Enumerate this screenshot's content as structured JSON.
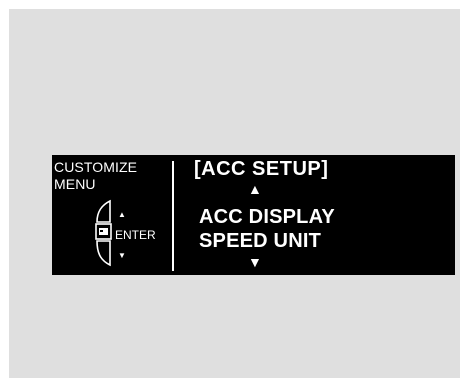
{
  "menu": {
    "title_line1": "CUSTOMIZE",
    "title_line2": "MENU",
    "enter_label": "ENTER",
    "selector_icon": "steering-switch-icon"
  },
  "display": {
    "heading": "[ACC SETUP]",
    "up_arrow": "▲",
    "options": [
      "ACC DISPLAY",
      "SPEED UNIT"
    ],
    "down_arrow": "▼"
  },
  "colors": {
    "screen_bg": "#000000",
    "text": "#ffffff",
    "panel_bg": "#dfdfdf"
  }
}
